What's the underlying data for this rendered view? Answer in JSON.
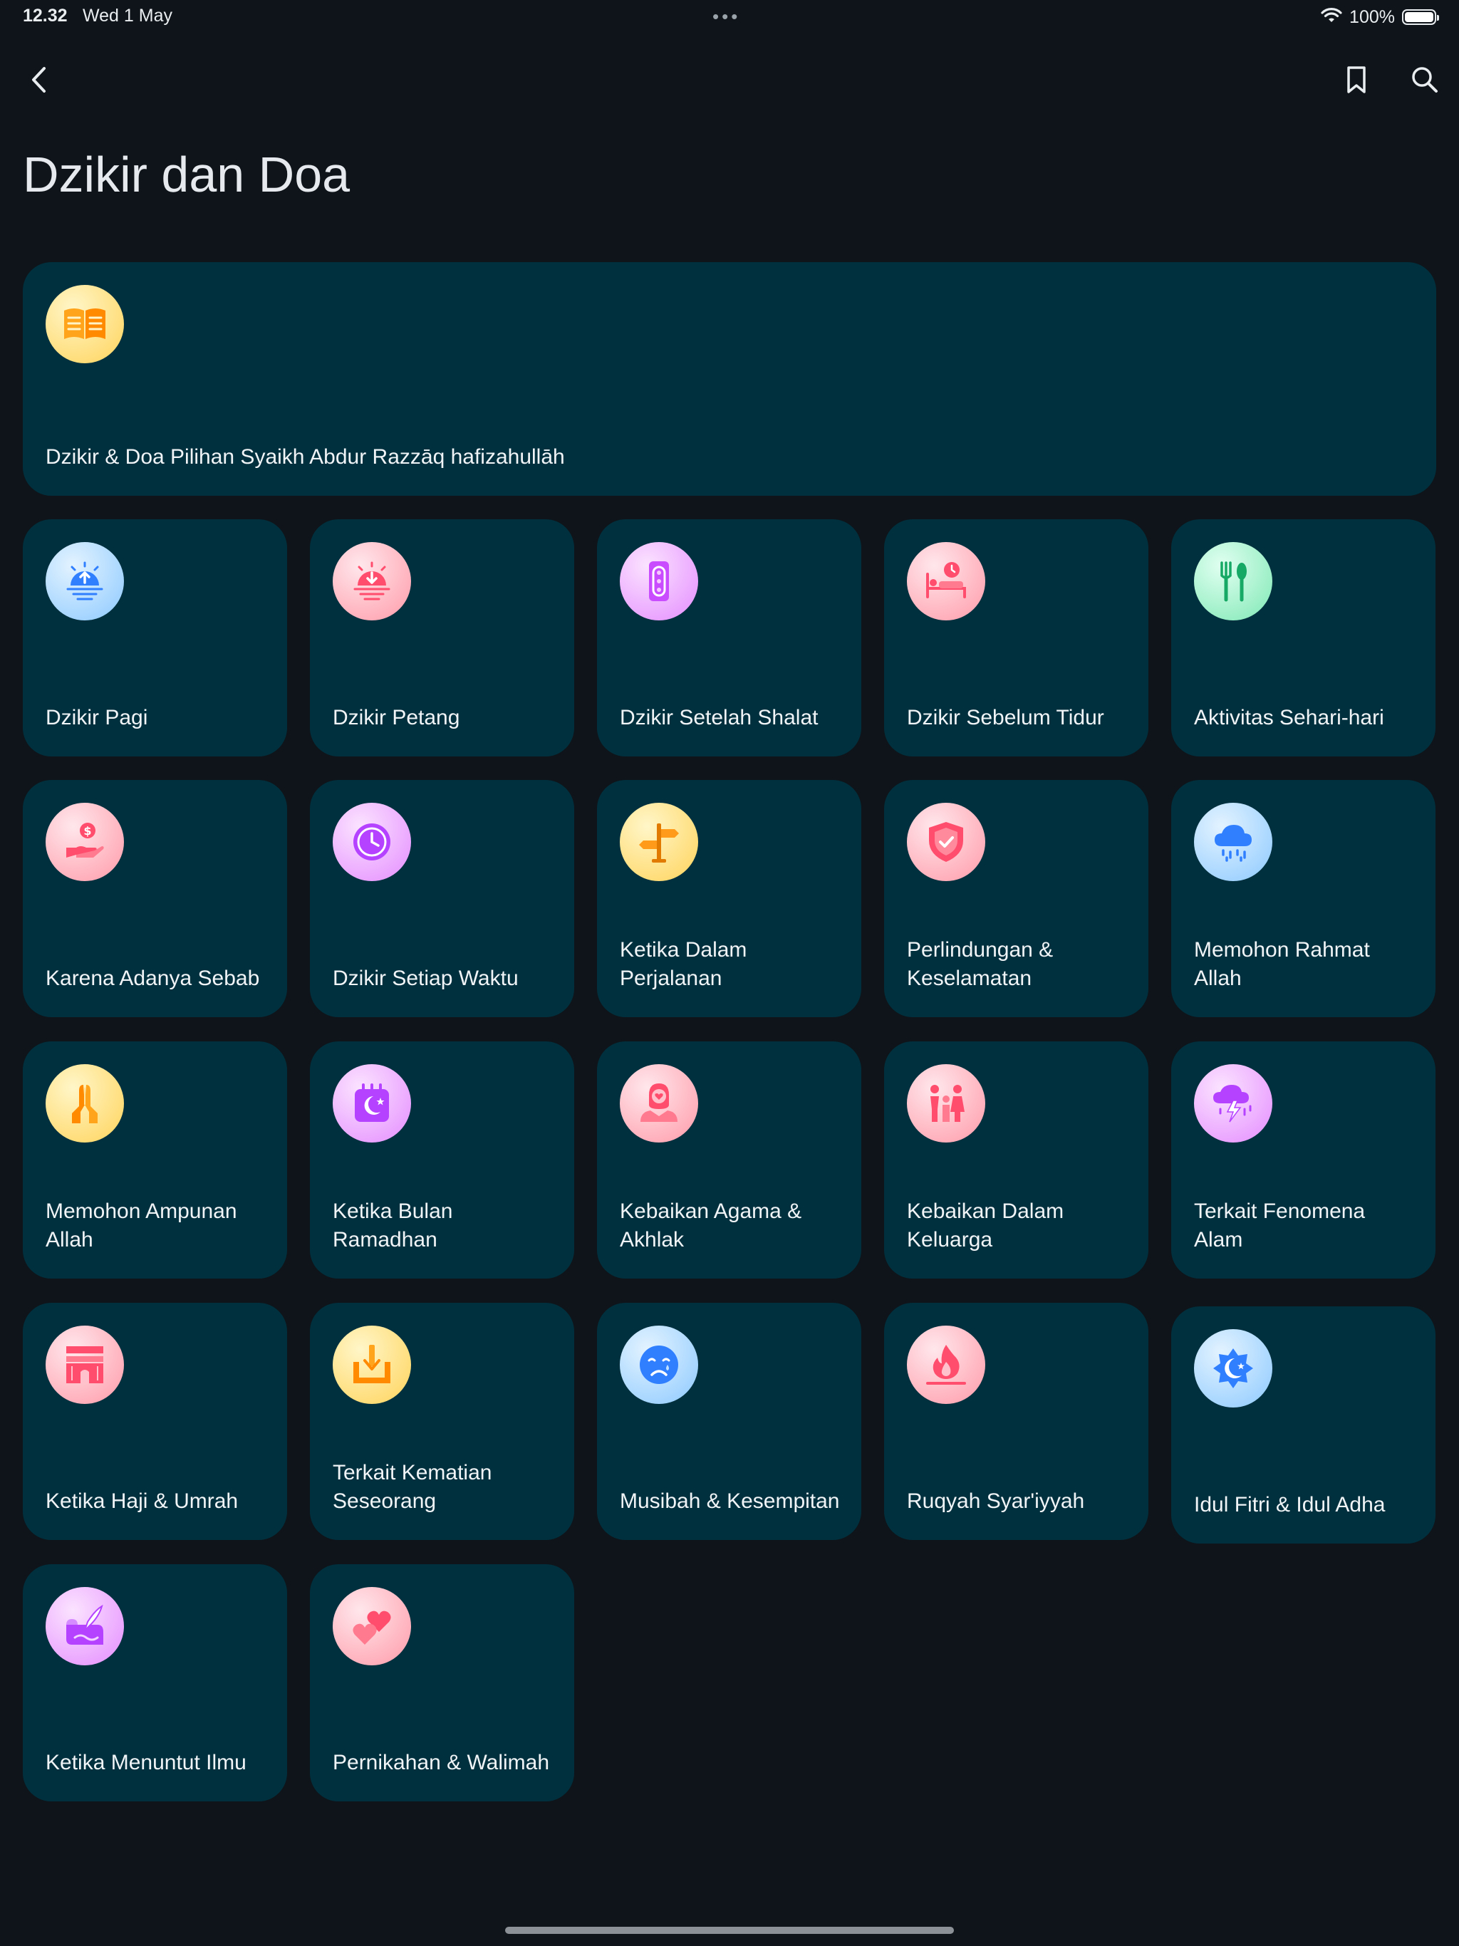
{
  "status_bar": {
    "time": "12.32",
    "date": "Wed 1 May",
    "dots": "•••",
    "battery": "100%"
  },
  "nav": {
    "back": "back-icon",
    "bookmark": "bookmark-icon",
    "search": "search-icon"
  },
  "page": {
    "title": "Dzikir dan Doa"
  },
  "featured": {
    "label": "Dzikir & Doa Pilihan Syaikh Abdur Razzāq hafizahullāh",
    "icon": "book-icon"
  },
  "categories": [
    {
      "label": "Dzikir Pagi",
      "icon": "sunrise-icon"
    },
    {
      "label": "Dzikir Petang",
      "icon": "sunset-icon"
    },
    {
      "label": "Dzikir Setelah Shalat",
      "icon": "prayer-beads-icon"
    },
    {
      "label": "Dzikir Sebelum Tidur",
      "icon": "bed-clock-icon"
    },
    {
      "label": "Aktivitas Sehari-hari",
      "icon": "fork-spoon-icon"
    },
    {
      "label": "Karena Adanya Sebab",
      "icon": "hand-coin-icon"
    },
    {
      "label": "Dzikir Setiap Waktu",
      "icon": "clock-icon"
    },
    {
      "label": "Ketika Dalam Perjalanan",
      "icon": "signpost-icon"
    },
    {
      "label": "Perlindungan & Keselamatan",
      "icon": "shield-icon"
    },
    {
      "label": "Memohon Rahmat Allah",
      "icon": "rain-cloud-icon"
    },
    {
      "label": "Memohon Ampunan Allah",
      "icon": "praying-hands-icon"
    },
    {
      "label": "Ketika Bulan Ramadhan",
      "icon": "crescent-calendar-icon"
    },
    {
      "label": "Kebaikan Agama & Akhlak",
      "icon": "person-heart-icon"
    },
    {
      "label": "Kebaikan Dalam Keluarga",
      "icon": "family-icon"
    },
    {
      "label": "Terkait Fenomena Alam",
      "icon": "storm-cloud-icon"
    },
    {
      "label": "Ketika Haji & Umrah",
      "icon": "kaaba-icon"
    },
    {
      "label": "Terkait Kematian Seseorang",
      "icon": "grave-icon"
    },
    {
      "label": "Musibah & Kesempitan",
      "icon": "sad-face-icon"
    },
    {
      "label": "Ruqyah Syar'iyyah",
      "icon": "flame-icon"
    },
    {
      "label": "Idul Fitri & Idul Adha",
      "icon": "star-crescent-icon"
    },
    {
      "label": "Ketika Menuntut Ilmu",
      "icon": "quill-scroll-icon"
    },
    {
      "label": "Pernikahan & Walimah",
      "icon": "hearts-icon"
    }
  ],
  "colors": {
    "background": "#0e1419",
    "card": "#00303e",
    "text": "#f1f4f6"
  }
}
